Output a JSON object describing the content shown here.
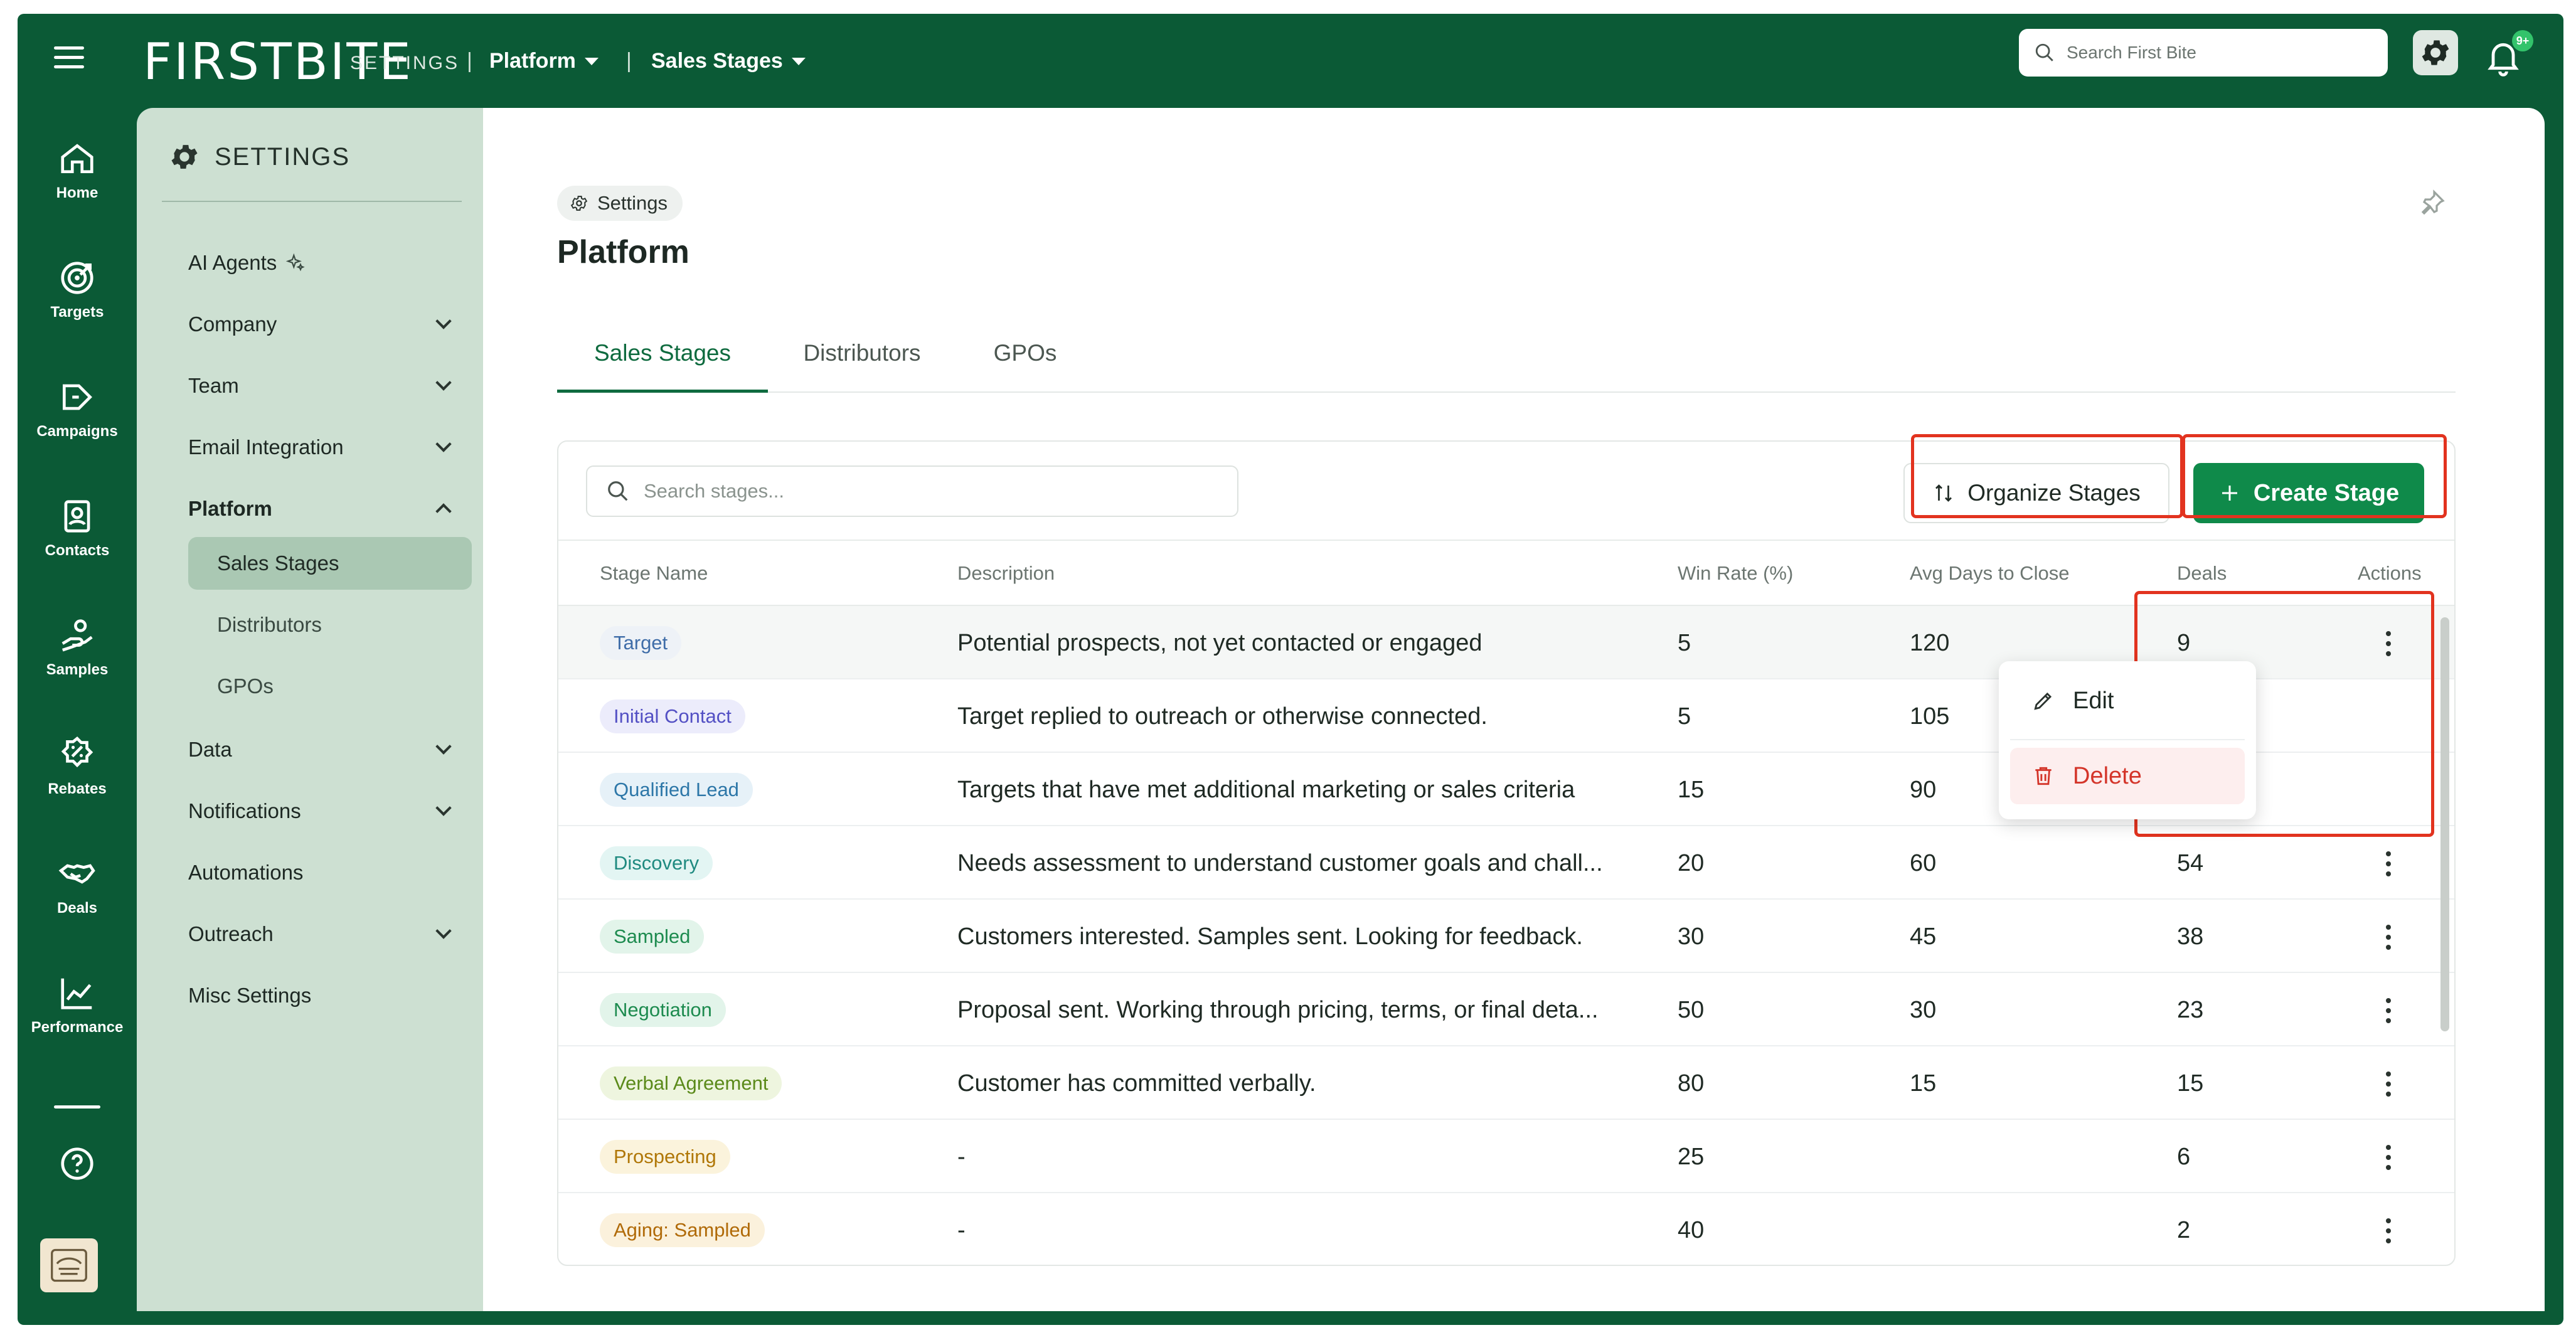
{
  "app": {
    "logo": "FIRSTBITE",
    "breadcrumb": {
      "section": "SETTINGS",
      "sep": "|",
      "platform": "Platform",
      "stages": "Sales Stages"
    },
    "search_placeholder": "Search First Bite",
    "notification_badge": "9+"
  },
  "rail": {
    "items": [
      {
        "label": "Home",
        "icon": "home-icon"
      },
      {
        "label": "Targets",
        "icon": "target-icon"
      },
      {
        "label": "Campaigns",
        "icon": "campaigns-icon"
      },
      {
        "label": "Contacts",
        "icon": "contacts-icon"
      },
      {
        "label": "Samples",
        "icon": "samples-icon"
      },
      {
        "label": "Rebates",
        "icon": "rebates-icon"
      },
      {
        "label": "Deals",
        "icon": "deals-icon"
      },
      {
        "label": "Performance",
        "icon": "performance-icon"
      }
    ]
  },
  "settings_panel": {
    "title": "SETTINGS",
    "items": {
      "ai_agents": "AI Agents",
      "company": "Company",
      "team": "Team",
      "email": "Email Integration",
      "platform": "Platform",
      "sales_stages": "Sales Stages",
      "distributors": "Distributors",
      "gpos": "GPOs",
      "data": "Data",
      "notifications": "Notifications",
      "automations": "Automations",
      "outreach": "Outreach",
      "misc": "Misc Settings"
    }
  },
  "main": {
    "chip": "Settings",
    "title": "Platform",
    "tabs": [
      "Sales Stages",
      "Distributors",
      "GPOs"
    ],
    "search_placeholder": "Search stages...",
    "organize_label": "Organize Stages",
    "create_label": "Create Stage",
    "columns": [
      "Stage Name",
      "Description",
      "Win Rate (%)",
      "Avg Days to Close",
      "Deals",
      "Actions"
    ],
    "rows": [
      {
        "stage": "Target",
        "desc": "Potential prospects, not yet contacted or engaged",
        "win": "5",
        "days": "120",
        "deals": "9",
        "bg": "#eef2f7",
        "fg": "#3f6da8"
      },
      {
        "stage": "Initial Contact",
        "desc": "Target replied to outreach or otherwise connected.",
        "win": "5",
        "days": "105",
        "deals": "",
        "bg": "#ececfb",
        "fg": "#5350c4"
      },
      {
        "stage": "Qualified Lead",
        "desc": "Targets that have met additional marketing or sales criteria",
        "win": "15",
        "days": "90",
        "deals": "",
        "bg": "#e6f1f8",
        "fg": "#2d77a8"
      },
      {
        "stage": "Discovery",
        "desc": "Needs assessment to understand customer goals and chall...",
        "win": "20",
        "days": "60",
        "deals": "54",
        "bg": "#e3f5f3",
        "fg": "#1f8a80"
      },
      {
        "stage": "Sampled",
        "desc": "Customers interested. Samples sent. Looking for feedback.",
        "win": "30",
        "days": "45",
        "deals": "38",
        "bg": "#e2f4ea",
        "fg": "#1d8b4f"
      },
      {
        "stage": "Negotiation",
        "desc": "Proposal sent. Working through pricing, terms, or final deta...",
        "win": "50",
        "days": "30",
        "deals": "23",
        "bg": "#e2f4ea",
        "fg": "#1d8b4f"
      },
      {
        "stage": "Verbal Agreement",
        "desc": "Customer has committed verbally.",
        "win": "80",
        "days": "15",
        "deals": "15",
        "bg": "#eef5df",
        "fg": "#5b8a1a"
      },
      {
        "stage": "Prospecting",
        "desc": "-",
        "win": "25",
        "days": "",
        "deals": "6",
        "bg": "#fbf3dc",
        "fg": "#b07708"
      },
      {
        "stage": "Aging: Sampled",
        "desc": "-",
        "win": "40",
        "days": "",
        "deals": "2",
        "bg": "#fbf1dc",
        "fg": "#b06a08"
      }
    ],
    "menu": {
      "edit": "Edit",
      "delete": "Delete"
    }
  },
  "colors": {
    "brand": "#0b5a36",
    "accent": "#0f8a4a",
    "highlight": "#e2331f",
    "danger": "#d4352a"
  }
}
